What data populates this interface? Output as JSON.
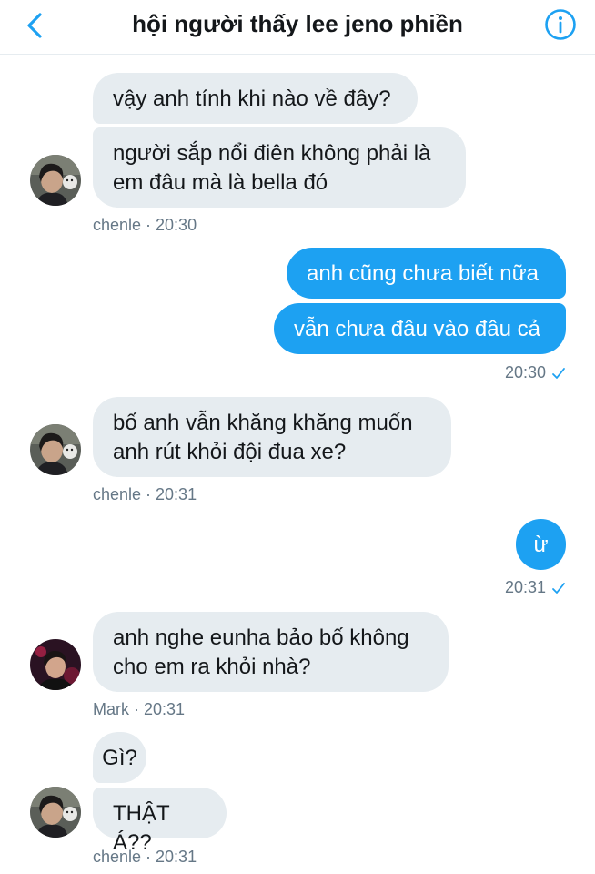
{
  "header": {
    "title": "hội người thấy lee jeno phiền",
    "back_icon": "chevron-left-icon",
    "info_icon": "info-icon",
    "accent_color": "#1da1f2"
  },
  "messages": [
    {
      "sender": "incoming",
      "text": "vậy anh tính khi nào về đây?"
    },
    {
      "sender": "incoming",
      "text": "người sắp nổi điên không phải là\nem đâu mà là bella đó"
    },
    {
      "sender": "outgoing",
      "text": "anh cũng chưa biết nữa"
    },
    {
      "sender": "outgoing",
      "text": "vẫn chưa đâu vào đâu cả"
    },
    {
      "sender": "incoming",
      "text": "bố anh vẫn khăng khăng muốn\nanh rút khỏi đội đua xe?"
    },
    {
      "sender": "outgoing",
      "text": "ừ"
    },
    {
      "sender": "incoming",
      "text": "anh nghe eunha bảo bố không\ncho em ra khỏi nhà?"
    },
    {
      "sender": "incoming",
      "text": "Gì?"
    },
    {
      "sender": "incoming",
      "text": "THẬT Á??"
    }
  ],
  "meta": {
    "m1": "chenle · 20:30",
    "m2": "20:30",
    "m3": "chenle · 20:31",
    "m4": "20:31",
    "m5": "Mark · 20:31",
    "m6": "chenle · 20:31"
  },
  "colors": {
    "incoming_bubble": "#e6ecf0",
    "outgoing_bubble": "#1da1f2",
    "meta_text": "#657786"
  }
}
